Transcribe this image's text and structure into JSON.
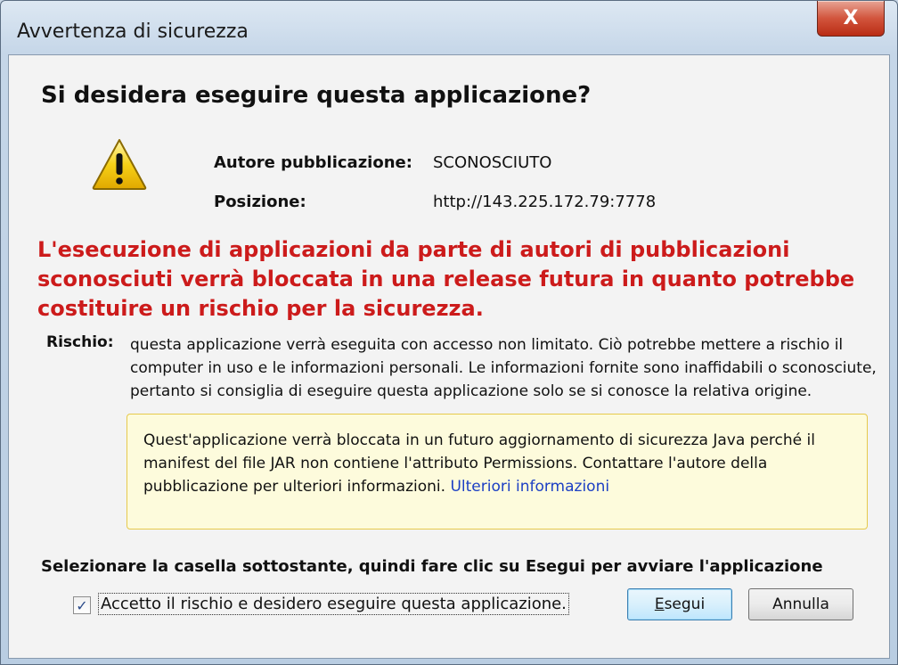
{
  "window": {
    "title": "Avvertenza di sicurezza",
    "close_label": "X"
  },
  "header": {
    "heading": "Si desidera eseguire questa applicazione?"
  },
  "info": {
    "publisher_label": "Autore pubblicazione:",
    "publisher_value": "SCONOSCIUTO",
    "location_label": "Posizione:",
    "location_value": "http://143.225.172.79:7778"
  },
  "warning": {
    "text": "L'esecuzione di applicazioni da parte di autori di pubblicazioni sconosciuti verrà bloccata in una release futura in quanto potrebbe costituire un rischio per la sicurezza."
  },
  "risk": {
    "label": "Rischio:",
    "text": "questa applicazione verrà eseguita con accesso non limitato. Ciò potrebbe mettere a rischio il computer in uso e le informazioni personali. Le informazioni fornite sono inaffidabili o sconosciute, pertanto si consiglia di eseguire questa applicazione solo se si conosce la relativa origine."
  },
  "notice": {
    "text": "Quest'applicazione verrà bloccata in un futuro aggiornamento di sicurezza Java perché il manifest del file JAR non contiene l'attributo Permissions. Contattare l'autore della pubblicazione per ulteriori informazioni.",
    "link_label": "Ulteriori informazioni"
  },
  "instruction": "Selezionare la casella sottostante, quindi fare clic su Esegui per avviare l'applicazione",
  "accept": {
    "checked": true,
    "label": "Accetto il rischio e desidero eseguire questa applicazione."
  },
  "buttons": {
    "run_first": "E",
    "run_rest": "segui",
    "cancel": "Annulla"
  },
  "colors": {
    "warning_red": "#cc1b1b",
    "link_blue": "#1c3fc4",
    "notice_bg": "#fdfbdc",
    "icon_yellow": "#f6d117"
  },
  "icons": {
    "warning": "warning-triangle-icon",
    "check": "checkmark-icon"
  }
}
